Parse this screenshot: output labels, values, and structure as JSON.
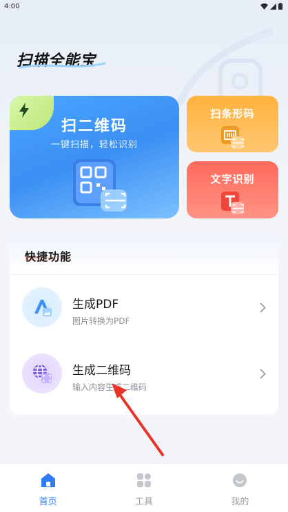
{
  "status_bar": {
    "time": "4:00"
  },
  "app": {
    "title": "扫描全能宝"
  },
  "cards": {
    "qr": {
      "title": "扫二维码",
      "subtitle": "一键扫描，轻松识别"
    },
    "barcode": {
      "title": "扫条形码"
    },
    "text_ocr": {
      "title": "文字识别"
    }
  },
  "quick": {
    "title": "快捷功能",
    "items": [
      {
        "name": "生成PDF",
        "desc": "图片转换为PDF",
        "icon": "pdf-create-icon"
      },
      {
        "name": "生成二维码",
        "desc": "输入内容生成二维码",
        "icon": "qr-create-icon"
      }
    ]
  },
  "nav": {
    "items": [
      {
        "label": "首页",
        "icon": "home-icon",
        "active": true
      },
      {
        "label": "工具",
        "icon": "grid-icon",
        "active": false
      },
      {
        "label": "我的",
        "icon": "profile-icon",
        "active": false
      }
    ]
  },
  "colors": {
    "accent": "#2f7cf6",
    "qr_card": "#3b8ff3",
    "barcode_card": "#ffb23e",
    "text_card": "#ff6a5b",
    "annotation": "#e8322a"
  }
}
